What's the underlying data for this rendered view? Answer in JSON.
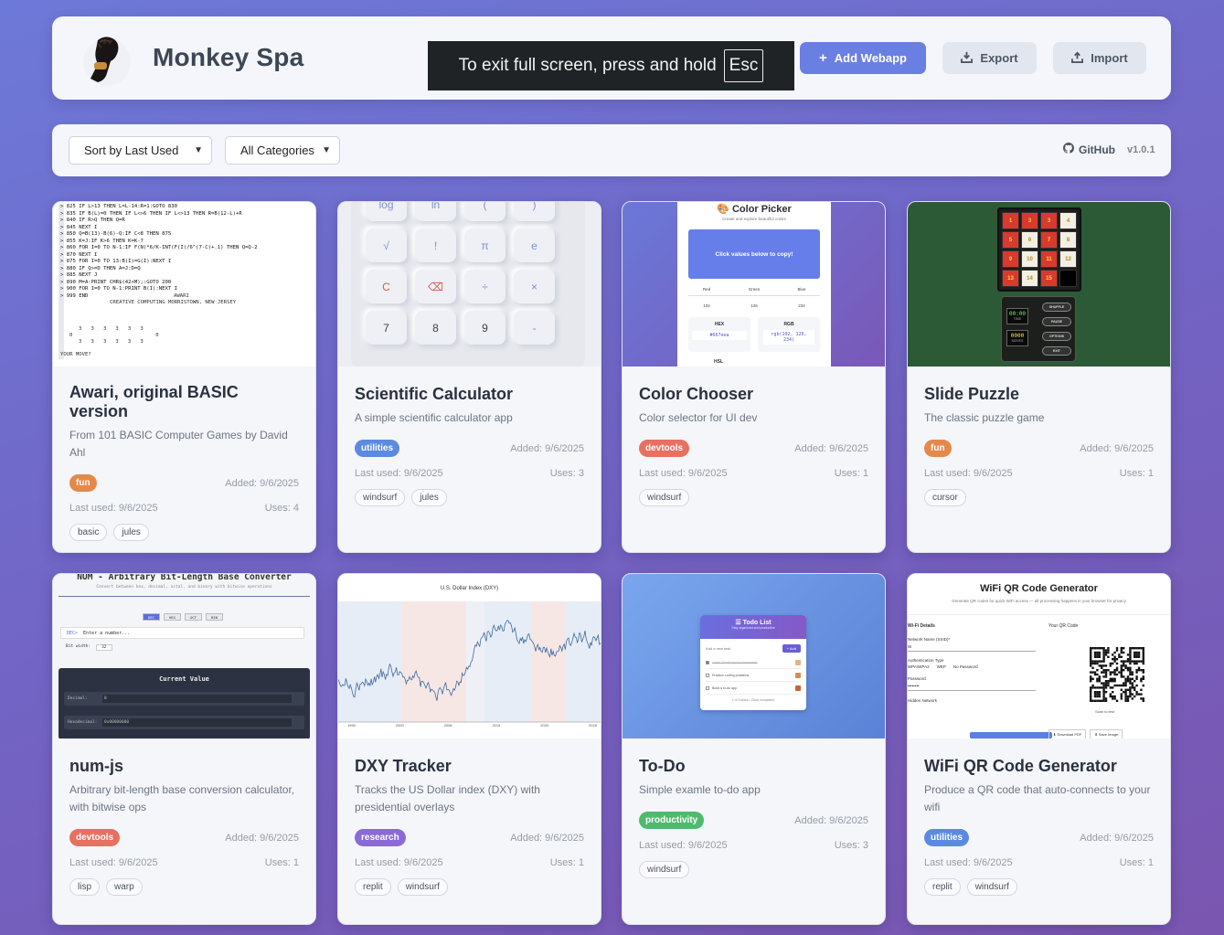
{
  "header": {
    "title": "Monkey Spa",
    "fullscreen_notice": "To exit full screen, press and hold",
    "fullscreen_key": "Esc",
    "add_label": "Add Webapp",
    "export_label": "Export",
    "import_label": "Import"
  },
  "toolbar": {
    "sort_value": "Sort by Last Used",
    "category_value": "All Categories",
    "github_label": "GitHub",
    "version": "v1.0.1"
  },
  "colors": {
    "accent": "#6a7fe2",
    "fun": "#e4894b",
    "utilities": "#5b8ae0",
    "devtools": "#e87061",
    "research": "#8a6ad8",
    "productivity": "#4fba6d"
  },
  "apps": [
    {
      "title": "Awari, original BASIC version",
      "description": "From 101 BASIC Computer Games by David Ahl",
      "category": "fun",
      "added": "Added: 9/6/2025",
      "last_used": "Last used: 9/6/2025",
      "uses": "Uses: 4",
      "tags": [
        "basic",
        "jules"
      ]
    },
    {
      "title": "Scientific Calculator",
      "description": "A simple scientific calculator app",
      "category": "utilities",
      "added": "Added: 9/6/2025",
      "last_used": "Last used: 9/6/2025",
      "uses": "Uses: 3",
      "tags": [
        "windsurf",
        "jules"
      ]
    },
    {
      "title": "Color Chooser",
      "description": "Color selector for UI dev",
      "category": "devtools",
      "added": "Added: 9/6/2025",
      "last_used": "Last used: 9/6/2025",
      "uses": "Uses: 1",
      "tags": [
        "windsurf"
      ]
    },
    {
      "title": "Slide Puzzle",
      "description": "The classic puzzle game",
      "category": "fun",
      "added": "Added: 9/6/2025",
      "last_used": "Last used: 9/6/2025",
      "uses": "Uses: 1",
      "tags": [
        "cursor"
      ]
    },
    {
      "title": "num-js",
      "description": "Arbitrary bit-length base conversion calculator, with bitwise ops",
      "category": "devtools",
      "added": "Added: 9/6/2025",
      "last_used": "Last used: 9/6/2025",
      "uses": "Uses: 1",
      "tags": [
        "lisp",
        "warp"
      ]
    },
    {
      "title": "DXY Tracker",
      "description": "Tracks the US Dollar index (DXY) with presidential overlays",
      "category": "research",
      "added": "Added: 9/6/2025",
      "last_used": "Last used: 9/6/2025",
      "uses": "Uses: 1",
      "tags": [
        "replit",
        "windsurf"
      ]
    },
    {
      "title": "To-Do",
      "description": "Simple examle to-do app",
      "category": "productivity",
      "added": "Added: 9/6/2025",
      "last_used": "Last used: 9/6/2025",
      "uses": "Uses: 3",
      "tags": [
        "windsurf"
      ]
    },
    {
      "title": "WiFi QR Code Generator",
      "description": "Produce a QR code that auto-connects to your wifi",
      "category": "utilities",
      "added": "Added: 9/6/2025",
      "last_used": "Last used: 9/6/2025",
      "uses": "Uses: 1",
      "tags": [
        "replit",
        "windsurf"
      ]
    }
  ],
  "thumbs": {
    "awari_lines": [
      "> 825 IF L>13 THEN L=L-14:R=1:GOTO 830",
      "> 835 IF B(L)=0 THEN IF L<>6 THEN IF L<>13 THEN R=B(12-L)+R",
      "> 840 IF R>Q THEN Q=R",
      "> 845 NEXT I",
      "> 850 Q=B(13)-B(6)-Q:IF C<8 THEN 875",
      "> 855 K=J:IF K>6 THEN K=K-7",
      "> 860 FOR I=0 TO N-1:IF F(N)*6/K-INT(F(I)/6^(7-C)+.1) THEN Q=Q-2",
      "> 870 NEXT I",
      "> 875 FOR I=0 TO 13:B(I)=G(I):NEXT I",
      "> 880 IF Q>=D THEN A=J:D=Q",
      "> 885 NEXT J",
      "> 890 M=A:PRINT CHR$(42+M);:GOTO 200",
      "> 900 FOR I=0 TO N-1:PRINT B(I):NEXT I",
      "> 999 END"
    ],
    "awari_title": "AWARI",
    "awari_sub": "CREATIVE COMPUTING  MORRISTOWN, NEW JERSEY",
    "awari_row1": "3   3   3   3   3   3",
    "awari_mid": "0                           0",
    "awari_row2": "3   3   3   3   3   3",
    "awari_prompt": "YOUR MOVE?",
    "calc_keys": [
      "log",
      "ln",
      "(",
      ")",
      "√",
      "!",
      "π",
      "e",
      "C",
      "⌫",
      "÷",
      "×",
      "7",
      "8",
      "9",
      "-"
    ],
    "color_title": "🎨 Color Picker",
    "color_sub": "Create and explore beautiful colors",
    "color_box": "Click values below to copy!",
    "color_labels": [
      "Red",
      "Green",
      "Blue"
    ],
    "color_values": [
      "102",
      "126",
      "234"
    ],
    "color_hex_label": "HEX",
    "color_hex": "#667eea",
    "color_rgb_label": "RGB",
    "color_rgb": "rgb(102, 126, 234)",
    "color_hsl_label": "HSL",
    "puzzle_tiles": [
      "1",
      "3",
      "3",
      "4",
      "5",
      "6",
      "7",
      "8",
      "9",
      "10",
      "11",
      "12",
      "13",
      "14",
      "15",
      ""
    ],
    "puzzle_timer": "00:00",
    "puzzle_timer_label": "TIME",
    "puzzle_moves": "0000",
    "puzzle_moves_label": "MOVES",
    "puzzle_buttons": [
      "SHUFFLE",
      "PAUSE",
      "OPTIONS",
      "EXIT"
    ],
    "num_title": "NUM - Arbitrary Bit-Length Base Converter",
    "num_sub": "Convert between hex, decimal, octal, and binary with bitwise operations",
    "num_tabs": [
      "DEC",
      "HEX",
      "OCT",
      "BIN"
    ],
    "num_input_label": "DEC>",
    "num_placeholder": "Enter a number...",
    "num_bitwidth_label": "Bit width:",
    "num_bitwidth": "32",
    "num_current": "Current Value",
    "num_dec_label": "Decimal:",
    "num_dec_value": "0",
    "num_hex_label": "Hexadecimal:",
    "num_hex_value": "0x00000000",
    "dxy_title": "U.S. Dollar Index (DXY)",
    "dxy_x_ticks": [
      "1990",
      "2000",
      "2008",
      "2015",
      "2020",
      "2025"
    ],
    "todo_title": "☰ Todo List",
    "todo_sub": "Stay organized and productive",
    "todo_placeholder": "Add a new task",
    "todo_add": "+ Add",
    "todo_items": [
      "Learn JavaScript fundamentals",
      "Practice coding problems",
      "Build a to-do app"
    ],
    "todo_footer": "1 of 3 tasks • Clear completed",
    "qr_title": "WiFi QR Code Generator",
    "qr_sub": "Generate QR codes for quick WiFi access — all processing happens in your browser for privacy",
    "qr_details": "Wi-Fi Details",
    "qr_ssid_label": "Network Name (SSID)*",
    "qr_ssid_value": "W",
    "qr_auth_label": "Authentication Type",
    "qr_auth_options": [
      "WPA/WPA2",
      "WEP",
      "No Password"
    ],
    "qr_pass_label": "Password",
    "qr_pass_value": "••••••••",
    "qr_hidden_label": "Hidden Network",
    "qr_code_label": "Your QR Code",
    "qr_scan": "Scan to test",
    "qr_download": "⬇ Download PDF",
    "qr_save": "⬇ Save Image"
  }
}
